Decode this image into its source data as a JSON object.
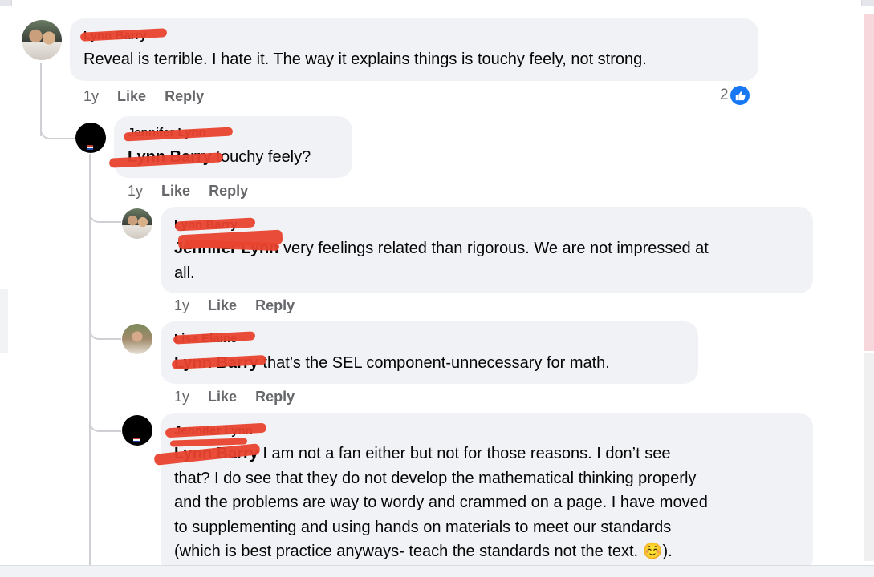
{
  "comments": [
    {
      "author": "Lynn Barry",
      "text": "Reveal is terrible. I hate it. The way it explains things is touchy feely, not strong.",
      "time": "1y",
      "like": "Like",
      "reply": "Reply",
      "reactions": "2"
    },
    {
      "author": "Jennifer Lynn",
      "mention": "Lynn Barry",
      "text": " touchy feely?",
      "time": "1y",
      "like": "Like",
      "reply": "Reply"
    },
    {
      "author": "Lynn Barry",
      "mention": "Jennifer Lynn",
      "text_line1": " very feelings related than rigorous. We are not impressed at",
      "text_line2": "all.",
      "time": "1y",
      "like": "Like",
      "reply": "Reply"
    },
    {
      "author": "Lisa Elaine",
      "mention": "Lynn Barry",
      "text": " that’s the SEL component-unnecessary for math.",
      "time": "1y",
      "like": "Like",
      "reply": "Reply"
    },
    {
      "author": "Jennifer Lynn",
      "mention": "Lynn Barry",
      "text_line1": " I am not a fan either but not for those reasons. I don’t see",
      "text_line2": "that? I do see that they do not develop the mathematical thinking properly",
      "text_line3": "and the problems are way to wordy and crammed on a page. I have moved",
      "text_line4": "to supplementing and using hands on materials to meet our standards",
      "text_line5": "(which is best practice anyways- teach the standards not the text. ☺️)."
    }
  ],
  "icons": {
    "reaction": "thumbs-up-icon"
  },
  "colors": {
    "bubble": "#f0f2f5",
    "meta": "#65676b",
    "like_blue": "#1877f2",
    "redaction": "#e8432e"
  }
}
